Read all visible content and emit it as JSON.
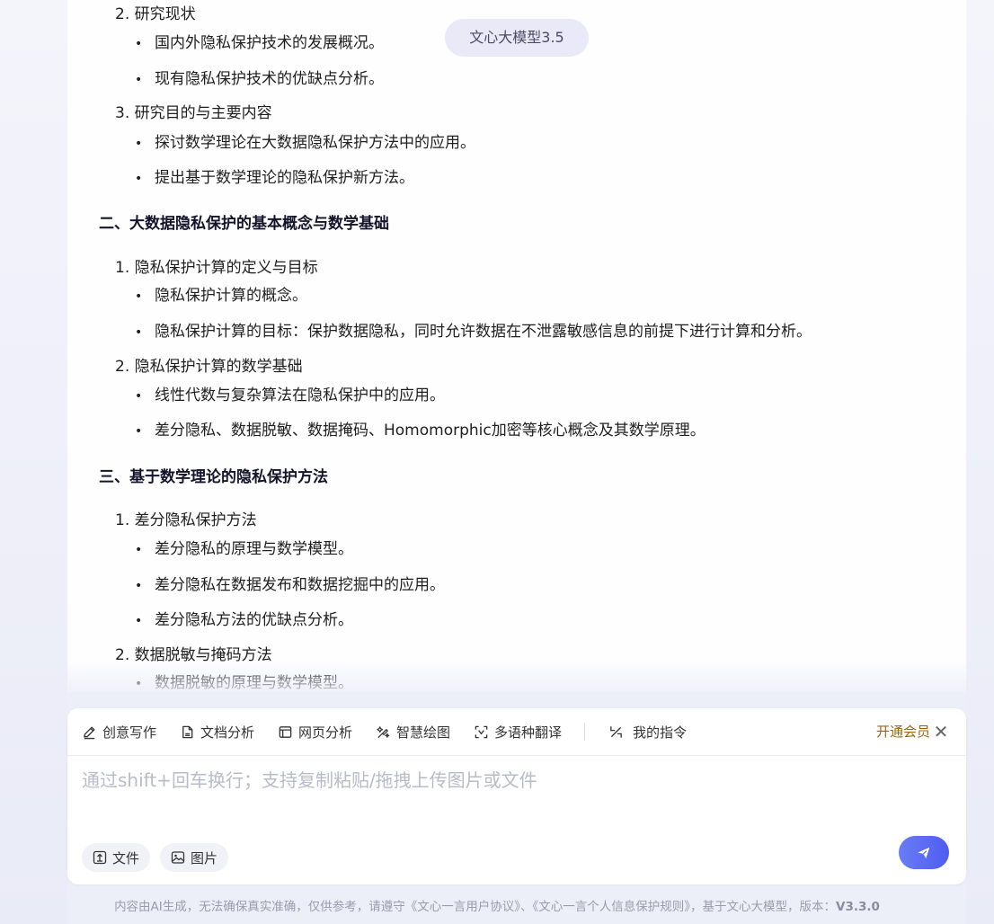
{
  "model_badge": "文心大模型3.5",
  "article": {
    "s1_item2": "2. 研究现状",
    "s1_item2_b1": "国内外隐私保护技术的发展概况。",
    "s1_item2_b2": "现有隐私保护技术的优缺点分析。",
    "s1_item3": "3. 研究目的与主要内容",
    "s1_item3_b1": "探讨数学理论在大数据隐私保护方法中的应用。",
    "s1_item3_b2": "提出基于数学理论的隐私保护新方法。",
    "s2_heading": "二、大数据隐私保护的基本概念与数学基础",
    "s2_item1": "1. 隐私保护计算的定义与目标",
    "s2_item1_b1": "隐私保护计算的概念。",
    "s2_item1_b2": "隐私保护计算的目标：保护数据隐私，同时允许数据在不泄露敏感信息的前提下进行计算和分析。",
    "s2_item2": "2. 隐私保护计算的数学基础",
    "s2_item2_b1": "线性代数与复杂算法在隐私保护中的应用。",
    "s2_item2_b2": "差分隐私、数据脱敏、数据掩码、Homomorphic加密等核心概念及其数学原理。",
    "s3_heading": "三、基于数学理论的隐私保护方法",
    "s3_item1": "1. 差分隐私保护方法",
    "s3_item1_b1": "差分隐私的原理与数学模型。",
    "s3_item1_b2": "差分隐私在数据发布和数据挖掘中的应用。",
    "s3_item1_b3": "差分隐私方法的优缺点分析。",
    "s3_item2": "2. 数据脱敏与掩码方法",
    "s3_item2_b1": "数据脱敏的原理与数学模型。"
  },
  "toolbar": {
    "creative_writing": "创意写作",
    "doc_analysis": "文档分析",
    "web_analysis": "网页分析",
    "smart_drawing": "智慧绘图",
    "translate": "多语种翻译",
    "my_commands": "我的指令",
    "vip": "开通会员"
  },
  "input": {
    "placeholder": "通过shift+回车换行；支持复制粘贴/拖拽上传图片或文件",
    "file_label": "文件",
    "image_label": "图片"
  },
  "footer": {
    "disclaimer": "内容由AI生成，无法确保真实准确，仅供参考，请遵守《文心一言用户协议》、《文心一言个人信息保护规则》，基于文心大模型，版本：",
    "version": "V3.3.0"
  },
  "colors": {
    "accent": "#4e5df2",
    "vip": "#a0640f",
    "background": "#eceef8"
  },
  "icons": [
    "pen-icon",
    "document-icon",
    "webpage-icon",
    "paint-icon",
    "translate-icon",
    "command-icon",
    "close-icon",
    "upload-icon",
    "image-icon",
    "send-icon"
  ]
}
